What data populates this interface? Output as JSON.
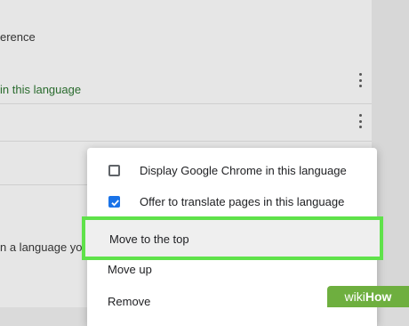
{
  "background_rows": {
    "row1": "erence",
    "row2": "in this language",
    "row3": "n a language you r"
  },
  "menu": {
    "items": [
      {
        "label": "Display Google Chrome in this language",
        "checked": false
      },
      {
        "label": "Offer to translate pages in this language",
        "checked": true
      }
    ],
    "actions": [
      {
        "label": "Move to the top",
        "highlighted": true
      },
      {
        "label": "Move up"
      },
      {
        "label": "Remove"
      }
    ]
  },
  "watermark": {
    "part1": "wiki",
    "part2": "How"
  },
  "colors": {
    "highlight_border": "#5fe24a",
    "checkbox_checked": "#1a73e8",
    "accent_text": "#2a6b2e",
    "watermark_bg": "#6eaf3f"
  }
}
